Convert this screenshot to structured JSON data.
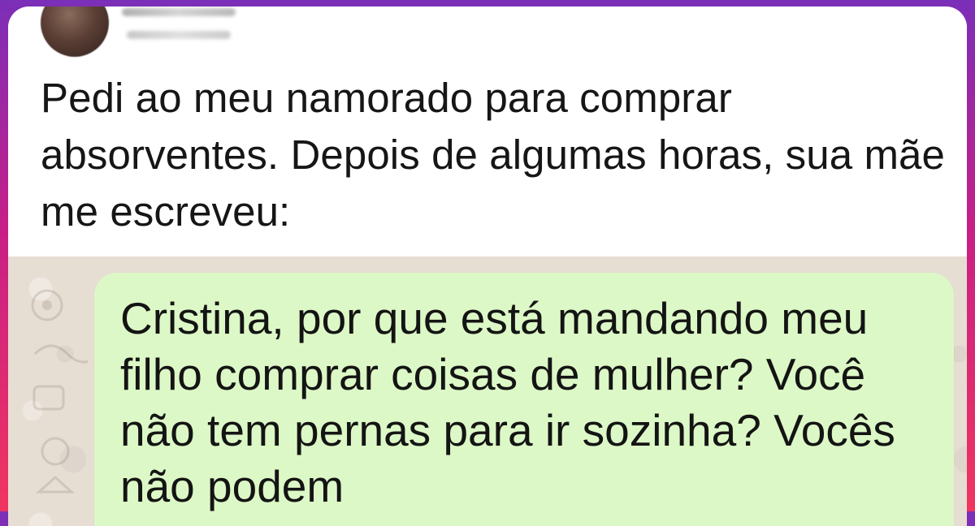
{
  "post": {
    "text": "Pedi ao meu namorado para comprar absorventes. Depois de algumas horas, sua mãe me escreveu:"
  },
  "chat": {
    "message": "Cristina, por que está mandando meu filho comprar coisas de mulher? Você não tem pernas para ir sozinha? Vocês não podem"
  },
  "colors": {
    "frame_gradient_top": "#7b2fb8",
    "frame_gradient_bottom": "#f0355f",
    "chat_background": "#e6ddd3",
    "bubble_background": "#dcf8c6"
  },
  "icons": {
    "avatar": "blurred-profile-photo"
  }
}
